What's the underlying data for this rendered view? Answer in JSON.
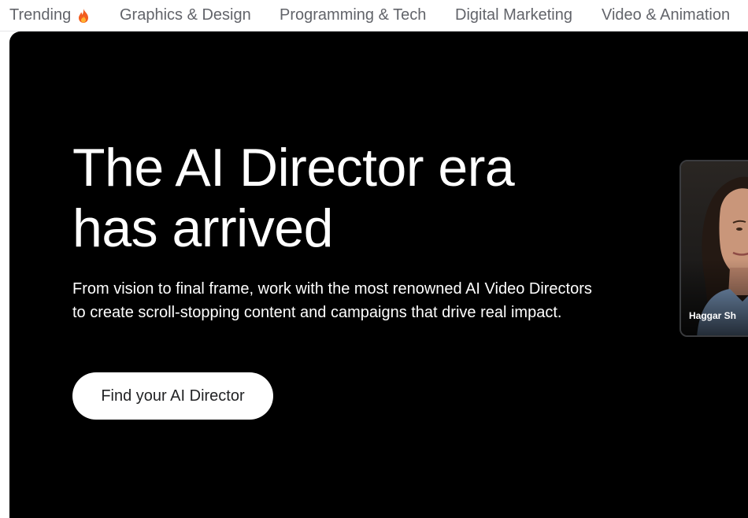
{
  "nav": {
    "items": [
      {
        "label": "Trending",
        "icon": "fire-icon"
      },
      {
        "label": "Graphics & Design"
      },
      {
        "label": "Programming & Tech"
      },
      {
        "label": "Digital Marketing"
      },
      {
        "label": "Video & Animation"
      }
    ]
  },
  "hero": {
    "headline_line1": "The AI Director era",
    "headline_line2": "has arrived",
    "description": "From vision to final frame, work with the most renowned AI Video Directors to create scroll-stopping content and campaigns that drive real impact.",
    "cta_label": "Find your AI Director",
    "background_color": "#000000"
  },
  "director_card": {
    "name": "Haggar Sh"
  },
  "colors": {
    "nav_text": "#62646a",
    "hero_text": "#ffffff",
    "cta_bg": "#ffffff",
    "cta_text": "#222325"
  }
}
